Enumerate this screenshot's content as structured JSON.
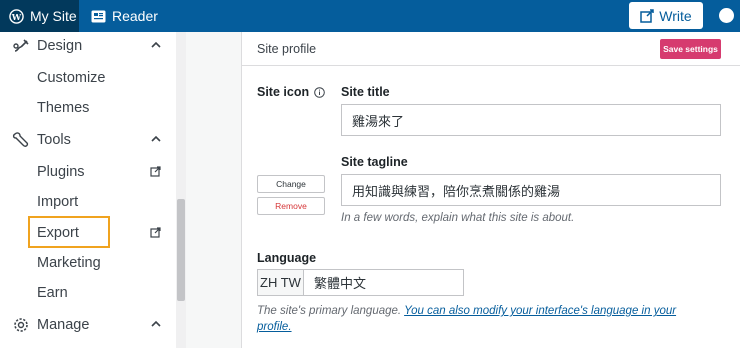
{
  "topbar": {
    "my_site": "My Site",
    "reader": "Reader",
    "write": "Write"
  },
  "sidebar": {
    "sections": [
      {
        "label": "Design",
        "icon": "brush-icon"
      },
      {
        "label": "Tools",
        "icon": "wrench-icon"
      },
      {
        "label": "Manage",
        "icon": "gear-icon"
      }
    ],
    "items": {
      "customize": "Customize",
      "themes": "Themes",
      "plugins": "Plugins",
      "import": "Import",
      "export": "Export",
      "marketing": "Marketing",
      "earn": "Earn"
    },
    "highlight_color": "#f0a31f"
  },
  "main": {
    "card_title": "Site profile",
    "save_label": "Save settings",
    "site_icon_label": "Site icon",
    "change_label": "Change",
    "remove_label": "Remove",
    "site_title_label": "Site title",
    "site_title_value": "雞湯來了",
    "site_tagline_label": "Site tagline",
    "site_tagline_value": "用知識與練習，陪你烹煮關係的雞湯",
    "tagline_hint": "In a few words, explain what this site is about.",
    "language_label": "Language",
    "language_code": "ZH TW",
    "language_value": "繁體中文",
    "language_hint_prefix": "The site's primary language. ",
    "language_hint_link": "You can also modify your interface's language in your profile."
  },
  "colors": {
    "topbar": "#055d9c",
    "topbar_active": "#02395c",
    "save_button": "#d63b6f",
    "link": "#055d9c"
  }
}
